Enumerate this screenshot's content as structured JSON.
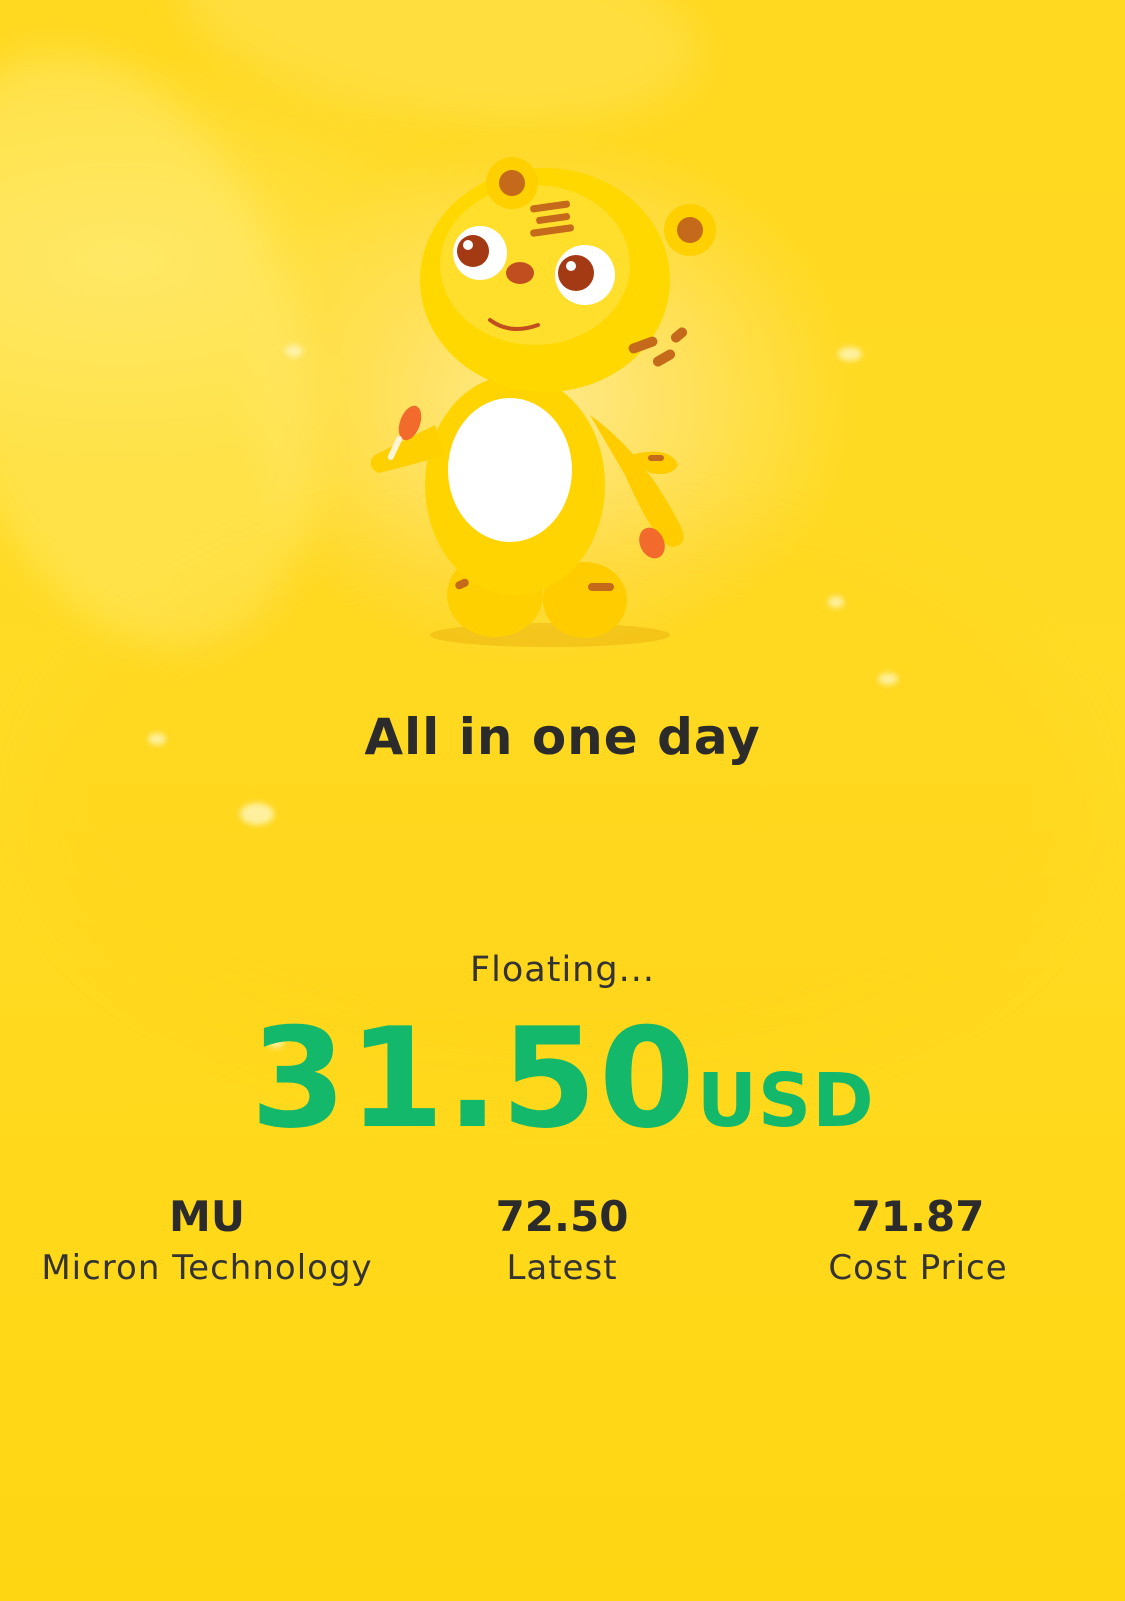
{
  "headline": "All in one day",
  "floating": {
    "label": "Floating...",
    "value": "31.50",
    "unit": "USD"
  },
  "stats": [
    {
      "value": "MU",
      "label": "Micron Technology"
    },
    {
      "value": "72.50",
      "label": "Latest"
    },
    {
      "value": "71.87",
      "label": "Cost Price"
    }
  ],
  "colors": {
    "background": "#ffd81f",
    "amount": "#14b86a",
    "text": "#2b2b2b"
  },
  "icons": {
    "mascot": "tiger-mascot-icon"
  }
}
